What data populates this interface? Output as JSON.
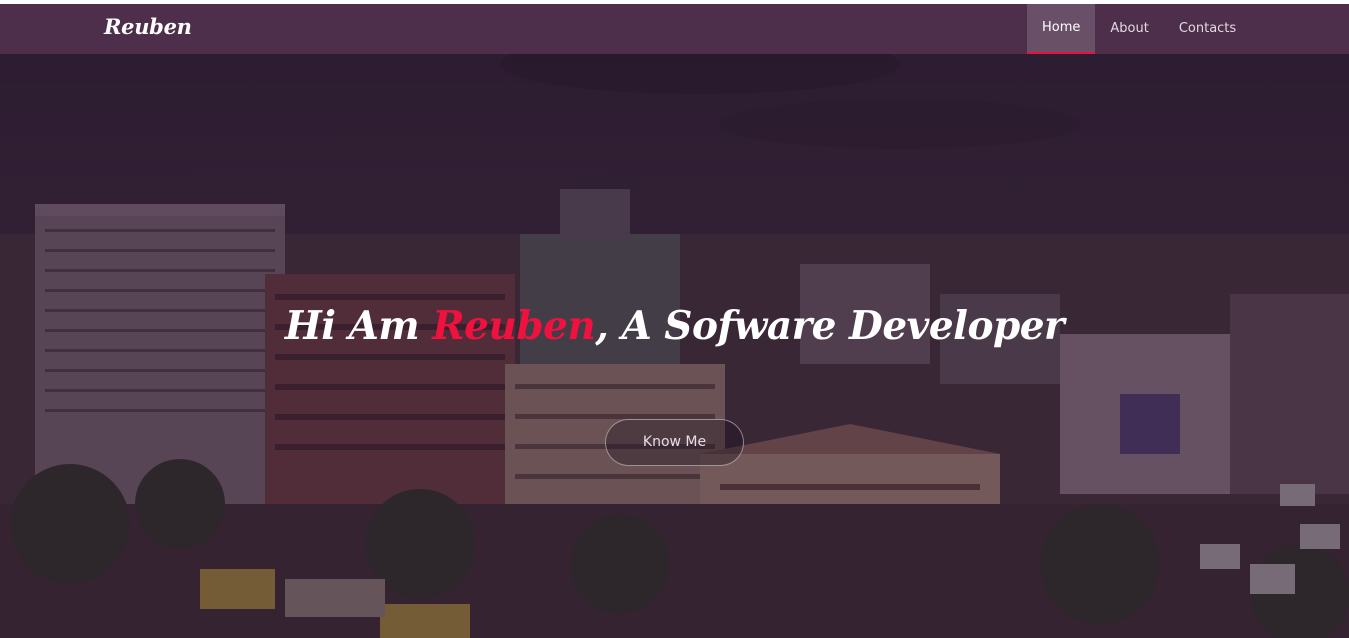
{
  "navbar": {
    "brand": "Reuben",
    "items": [
      {
        "label": "Home",
        "active": true
      },
      {
        "label": "About",
        "active": false
      },
      {
        "label": "Contacts",
        "active": false
      }
    ]
  },
  "hero": {
    "headline_prefix": "Hi Am ",
    "headline_name": "Reuben",
    "headline_suffix": ", A Sofware Developer",
    "cta_label": "Know Me"
  },
  "colors": {
    "navbar_bg": "#4e304c",
    "accent": "#f0113f",
    "overlay": "#2d182e"
  }
}
